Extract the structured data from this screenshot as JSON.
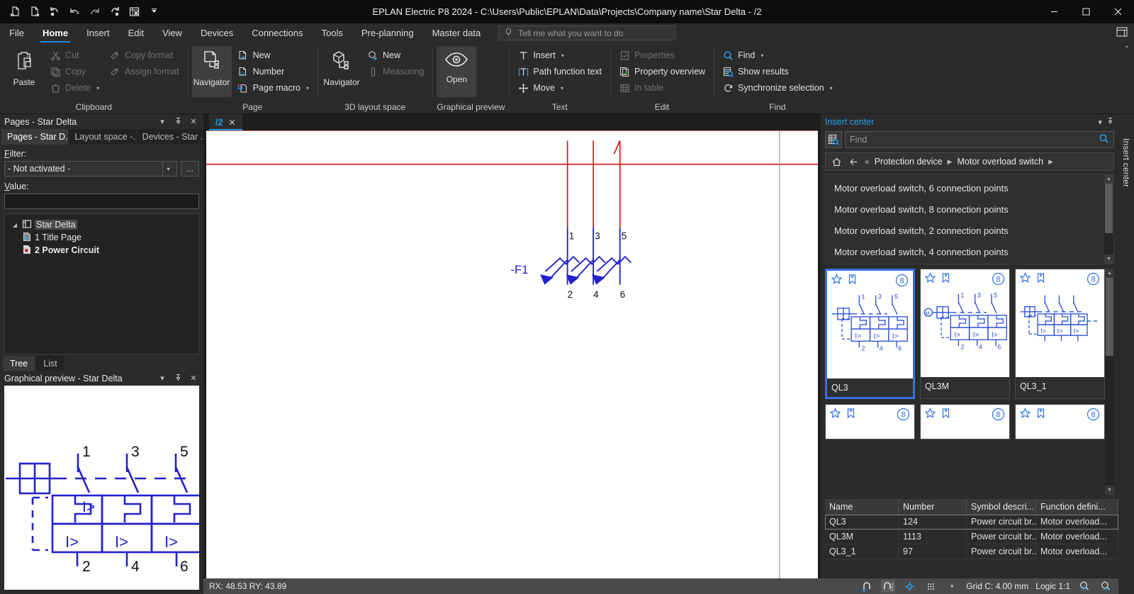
{
  "window": {
    "title": "EPLAN Electric P8 2024 - C:\\Users\\Public\\EPLAN\\Data\\Projects\\Company name\\Star Delta - /2",
    "minimize": "–",
    "maximize": "▢",
    "close": "✕"
  },
  "quick_access": [
    {
      "name": "open-page-back-icon",
      "glyph": "page-back"
    },
    {
      "name": "open-page-forward-icon",
      "glyph": "page-forward"
    },
    {
      "name": "undo-dropdown-icon",
      "glyph": "undo-dot"
    },
    {
      "name": "undo-icon",
      "glyph": "undo"
    },
    {
      "name": "redo-icon",
      "glyph": "redo"
    },
    {
      "name": "redo-dropdown-icon",
      "glyph": "redo-dot"
    },
    {
      "name": "cancel-action-icon",
      "glyph": "cancel-table"
    },
    {
      "name": "customize-quick-access-icon",
      "glyph": "chevron"
    }
  ],
  "menubar": {
    "items": [
      {
        "label": "File",
        "active": false
      },
      {
        "label": "Home",
        "active": true
      },
      {
        "label": "Insert",
        "active": false
      },
      {
        "label": "Edit",
        "active": false
      },
      {
        "label": "View",
        "active": false
      },
      {
        "label": "Devices",
        "active": false
      },
      {
        "label": "Connections",
        "active": false
      },
      {
        "label": "Tools",
        "active": false
      },
      {
        "label": "Pre-planning",
        "active": false
      },
      {
        "label": "Master data",
        "active": false
      }
    ],
    "tell_me_placeholder": "Tell me what you want to do"
  },
  "ribbon": {
    "groups": [
      {
        "label": "Clipboard",
        "big": {
          "label": "Paste",
          "icon": "paste-icon",
          "disabled": false
        },
        "cols": [
          [
            {
              "label": "Cut",
              "icon": "cut-icon",
              "disabled": true
            },
            {
              "label": "Copy",
              "icon": "copy-icon",
              "disabled": true
            },
            {
              "label": "Delete",
              "icon": "delete-icon",
              "disabled": true,
              "caret": true
            }
          ],
          [
            {
              "label": "Copy format",
              "icon": "copy-format-icon",
              "disabled": true
            },
            {
              "label": "Assign format",
              "icon": "assign-format-icon",
              "disabled": true
            }
          ]
        ]
      },
      {
        "label": "Page",
        "big": {
          "label": "Navigator",
          "icon": "page-navigator-icon",
          "selected": true
        },
        "cols": [
          [
            {
              "label": "New",
              "icon": "new-page-icon",
              "disabled": false
            },
            {
              "label": "Number",
              "icon": "number-pages-icon",
              "disabled": false
            },
            {
              "label": "Page macro",
              "icon": "page-macro-icon",
              "disabled": false,
              "caret": true
            }
          ]
        ]
      },
      {
        "label": "3D layout space",
        "big": {
          "label": "Navigator",
          "icon": "layout-navigator-icon"
        },
        "cols": [
          [
            {
              "label": "New",
              "icon": "new-3d-icon",
              "disabled": false
            },
            {
              "label": "Measuring",
              "icon": "measuring-icon",
              "disabled": true
            }
          ]
        ]
      },
      {
        "label": "Graphical preview",
        "big": {
          "label": "Open",
          "icon": "eye-icon",
          "selected": true
        }
      },
      {
        "label": "Text",
        "cols": [
          [
            {
              "label": "Insert",
              "icon": "text-insert-icon",
              "disabled": false,
              "caret": true
            },
            {
              "label": "Path function text",
              "icon": "path-function-text-icon",
              "disabled": false
            },
            {
              "label": "Move",
              "icon": "move-icon",
              "disabled": false,
              "caret": true
            }
          ]
        ]
      },
      {
        "label": "Edit",
        "cols": [
          [
            {
              "label": "Properties",
              "icon": "properties-icon",
              "disabled": true
            },
            {
              "label": "Property overview",
              "icon": "property-overview-icon",
              "disabled": false
            },
            {
              "label": "In table",
              "icon": "in-table-icon",
              "disabled": true
            }
          ]
        ]
      },
      {
        "label": "Find",
        "cols": [
          [
            {
              "label": "Find",
              "icon": "find-icon",
              "disabled": false,
              "caret": true
            },
            {
              "label": "Show results",
              "icon": "show-results-icon",
              "disabled": false
            },
            {
              "label": "Synchronize selection",
              "icon": "synchronize-selection-icon",
              "disabled": false,
              "caret": true
            }
          ]
        ]
      }
    ]
  },
  "pages_panel": {
    "title": "Pages - Star Delta",
    "tabs": [
      {
        "label": "Pages - Star D...",
        "active": true
      },
      {
        "label": "Layout space -...",
        "active": false
      },
      {
        "label": "Devices - Star ...",
        "active": false
      }
    ],
    "filter_label": "Filter:",
    "filter_value": "- Not activated -",
    "dots_label": "...",
    "value_label": "Value:",
    "value_text": "",
    "tree": [
      {
        "label": "Star Delta",
        "level": 0,
        "bold": false,
        "selected": true,
        "icon": "project-icon"
      },
      {
        "label": "1 Title Page",
        "level": 1,
        "bold": false,
        "selected": false,
        "icon": "title-page-icon"
      },
      {
        "label": "2 Power Circuit",
        "level": 1,
        "bold": true,
        "selected": false,
        "icon": "power-circuit-page-icon"
      }
    ],
    "bottom_tabs": [
      {
        "label": "Tree",
        "active": true
      },
      {
        "label": "List",
        "active": false
      }
    ]
  },
  "graphical_preview": {
    "title": "Graphical preview - Star Delta",
    "symbol_labels": {
      "top": [
        "1",
        "3",
        "5"
      ],
      "bottom": [
        "2",
        "4",
        "6"
      ],
      "contact": "I>"
    }
  },
  "document": {
    "tab_label": "/2",
    "tab_close": "✕",
    "placed_symbol": {
      "device_tag": "-F1",
      "top_terminals": [
        "1",
        "3",
        "5"
      ],
      "bottom_terminals": [
        "2",
        "4",
        "6"
      ]
    }
  },
  "insert_center": {
    "title": "Insert center",
    "search_placeholder": "Find",
    "breadcrumb": {
      "home_icon": "home-icon",
      "back_icon": "back-arrow-icon",
      "overflow": "«",
      "items": [
        "Protection device",
        "Motor overload switch"
      ]
    },
    "list_items": [
      "Motor overload switch, 6 connection points",
      "Motor overload switch, 8 connection points",
      "Motor overload switch, 2 connection points",
      "Motor overload switch, 4 connection points"
    ],
    "cards": [
      {
        "name": "QL3",
        "badge": "8",
        "selected": true,
        "variant": "plain"
      },
      {
        "name": "QL3M",
        "badge": "8",
        "selected": false,
        "variant": "motor"
      },
      {
        "name": "QL3_1",
        "badge": "8",
        "selected": false,
        "variant": "dashed"
      },
      {
        "name": "",
        "badge": "8",
        "selected": false,
        "variant": "empty"
      },
      {
        "name": "",
        "badge": "8",
        "selected": false,
        "variant": "empty"
      },
      {
        "name": "",
        "badge": "8",
        "selected": false,
        "variant": "empty"
      }
    ],
    "table": {
      "columns": [
        "Name",
        "Number",
        "Symbol descri...",
        "Function defini..."
      ],
      "rows": [
        {
          "cells": [
            "QL3",
            "124",
            "Power circuit br...",
            "Motor overload..."
          ],
          "selected": true
        },
        {
          "cells": [
            "QL3M",
            "1113",
            "Power circuit br...",
            "Motor overload..."
          ],
          "selected": false
        },
        {
          "cells": [
            "QL3_1",
            "97",
            "Power circuit br...",
            "Motor overload..."
          ],
          "selected": false
        }
      ]
    },
    "side_label": "Insert center"
  },
  "statusbar": {
    "coordinates": "RX: 48.53 RY: 43.89",
    "grid": "Grid C: 4.00 mm",
    "logic": "Logic 1:1",
    "icons": [
      {
        "name": "snap-to-grid-icon",
        "on": false
      },
      {
        "name": "snap-magnet-icon",
        "on": true
      },
      {
        "name": "object-snap-icon",
        "on": false
      },
      {
        "name": "grid-display-icon",
        "on": false
      },
      {
        "name": "grid-dropdown-icon",
        "on": false
      },
      {
        "name": "zoom-window-icon",
        "on": false
      },
      {
        "name": "zoom-level-icon",
        "on": false
      }
    ]
  },
  "colors": {
    "accent": "#1b8fd6",
    "link": "#2b9fe8",
    "selection": "#3c6fe0",
    "symbol_blue": "#2222cc",
    "wire_red": "#e01010"
  }
}
